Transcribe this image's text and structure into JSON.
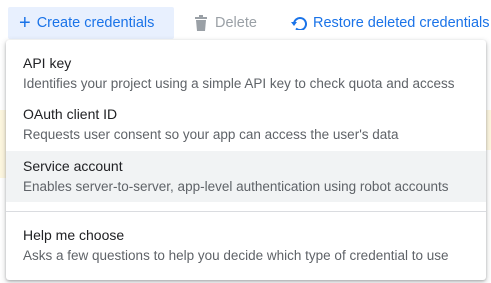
{
  "toolbar": {
    "create_label": "Create credentials",
    "delete_label": "Delete",
    "restore_label": "Restore deleted credentials"
  },
  "menu": {
    "items": [
      {
        "title": "API key",
        "description": "Identifies your project using a simple API key to check quota and access"
      },
      {
        "title": "OAuth client ID",
        "description": "Requests user consent so your app can access the user's data"
      },
      {
        "title": "Service account",
        "description": "Enables server-to-server, app-level authentication using robot accounts"
      },
      {
        "title": "Help me choose",
        "description": "Asks a few questions to help you decide which type of credential to use"
      }
    ],
    "highlighted_item": "Service account"
  },
  "icons": {
    "create": "plus-icon",
    "delete": "trash-icon",
    "restore": "restore-icon"
  },
  "colors": {
    "accent": "#1a73e8",
    "create_button_bg": "#e8f0fe",
    "disabled": "#9aa0a6",
    "highlight_bg": "#f1f3f4",
    "banner_bg": "#fef7e0"
  }
}
